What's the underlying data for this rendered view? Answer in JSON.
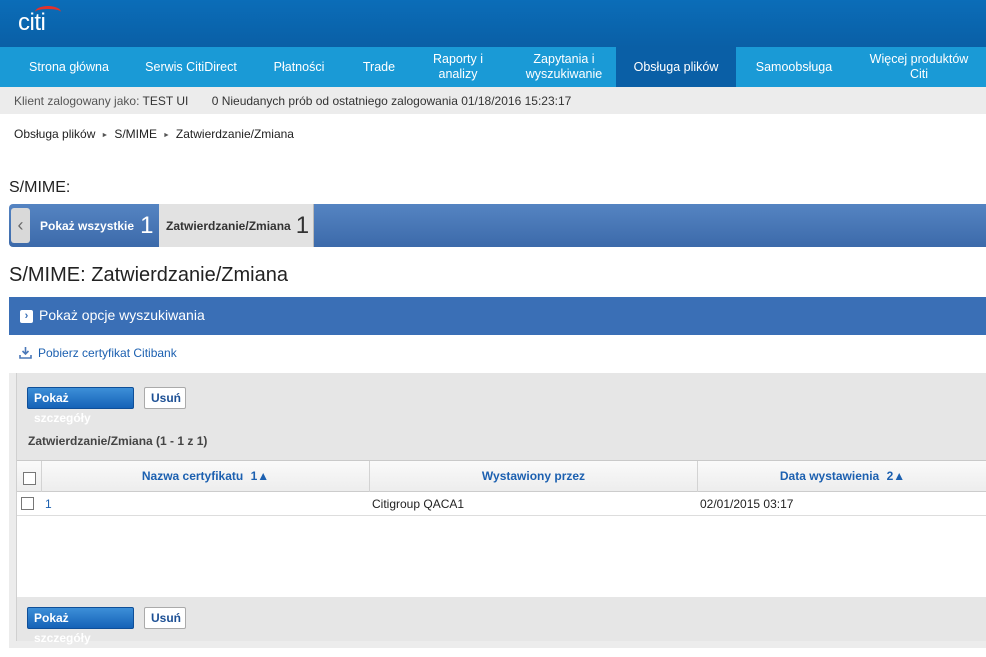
{
  "brand": {
    "logo_text": "citi",
    "accent_color": "#e3322c",
    "nav_color": "#1a9ad6",
    "active_nav_color": "#0a5fa6"
  },
  "nav": {
    "items": [
      {
        "label": "Strona główna"
      },
      {
        "label": "Serwis CitiDirect"
      },
      {
        "label": "Płatności"
      },
      {
        "label": "Trade"
      },
      {
        "label": "Raporty i analizy"
      },
      {
        "label": "Zapytania i wyszukiwanie"
      },
      {
        "label": "Obsługa plików",
        "active": true
      },
      {
        "label": "Samoobsługa"
      },
      {
        "label": "Więcej produktów Citi"
      }
    ]
  },
  "status": {
    "logged_as_label": "Klient zalogowany jako:",
    "user": "TEST UI",
    "failed_logins": "0 Nieudanych prób od ostatniego zalogowania 01/18/2016 15:23:17"
  },
  "breadcrumb": [
    "Obsługa plików",
    "S/MIME",
    "Zatwierdzanie/Zmiana"
  ],
  "section_label": "S/MIME:",
  "tabs": [
    {
      "label": "Pokaż wszystkie",
      "count": "1"
    },
    {
      "label": "Zatwierdzanie/Zmiana",
      "count": "1",
      "selected": true
    }
  ],
  "page_title": "S/MIME: Zatwierdzanie/Zmiana",
  "search_toggle": "Pokaż opcje wyszukiwania",
  "download_link": "Pobierz certyfikat Citibank",
  "actions": {
    "details": "Pokaż szczegóły",
    "delete": "Usuń"
  },
  "list_title": "Zatwierdzanie/Zmiana (1 - 1 z 1)",
  "table": {
    "columns": [
      {
        "label": "Nazwa certyfikatu",
        "sort": "1▲"
      },
      {
        "label": "Wystawiony przez",
        "sort": ""
      },
      {
        "label": "Data wystawienia",
        "sort": "2▲"
      }
    ],
    "rows": [
      {
        "name": "1",
        "issuer": "Citigroup QACA1",
        "date": "02/01/2015 03:17"
      }
    ]
  },
  "icons": {
    "prev": "chevron-left-icon",
    "expand": "chevron-right-icon",
    "download": "download-icon"
  }
}
